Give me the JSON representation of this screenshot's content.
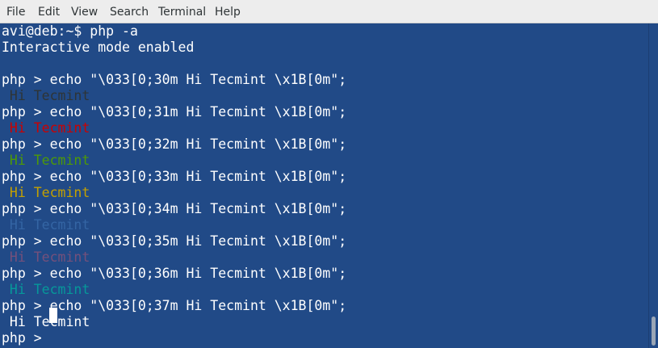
{
  "menubar": {
    "items": [
      "File",
      "Edit",
      "View",
      "Search",
      "Terminal",
      "Help"
    ]
  },
  "terminal": {
    "lines": [
      {
        "text": "avi@deb:~$ php -a",
        "color": "#ffffff"
      },
      {
        "text": "Interactive mode enabled",
        "color": "#ffffff"
      },
      {
        "text": "",
        "color": "#ffffff"
      },
      {
        "text": "php > echo \"\\033[0;30m Hi Tecmint \\x1B[0m\";",
        "color": "#ffffff"
      },
      {
        "text": " Hi Tecmint",
        "color": "#2e3436"
      },
      {
        "text": "php > echo \"\\033[0;31m Hi Tecmint \\x1B[0m\";",
        "color": "#ffffff"
      },
      {
        "text": " Hi Tecmint",
        "color": "#cc0000"
      },
      {
        "text": "php > echo \"\\033[0;32m Hi Tecmint \\x1B[0m\";",
        "color": "#ffffff"
      },
      {
        "text": " Hi Tecmint",
        "color": "#4e9a06"
      },
      {
        "text": "php > echo \"\\033[0;33m Hi Tecmint \\x1B[0m\";",
        "color": "#ffffff"
      },
      {
        "text": " Hi Tecmint",
        "color": "#c4a000"
      },
      {
        "text": "php > echo \"\\033[0;34m Hi Tecmint \\x1B[0m\";",
        "color": "#ffffff"
      },
      {
        "text": " Hi Tecmint",
        "color": "#3465a4"
      },
      {
        "text": "php > echo \"\\033[0;35m Hi Tecmint \\x1B[0m\";",
        "color": "#ffffff"
      },
      {
        "text": " Hi Tecmint",
        "color": "#75507b"
      },
      {
        "text": "php > echo \"\\033[0;36m Hi Tecmint \\x1B[0m\";",
        "color": "#ffffff"
      },
      {
        "text": " Hi Tecmint",
        "color": "#06989a"
      },
      {
        "text": "php > echo \"\\033[0;37m Hi Tecmint \\x1B[0m\";",
        "color": "#ffffff"
      },
      {
        "text": " Hi Tecmint",
        "color": "#ffffff"
      },
      {
        "text": "php > ",
        "color": "#ffffff"
      }
    ],
    "background": "#214a87"
  }
}
